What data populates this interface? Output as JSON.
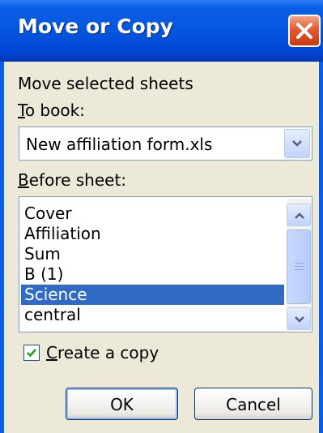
{
  "dialog": {
    "title": "Move or Copy",
    "intro": "Move selected sheets",
    "to_book_label_accel": "T",
    "to_book_label_rest": "o book:",
    "to_book_value": "New affiliation form.xls",
    "before_sheet_label_accel": "B",
    "before_sheet_label_rest": "efore sheet:",
    "sheets": [
      {
        "label": "Cover",
        "selected": false
      },
      {
        "label": "Affiliation",
        "selected": false
      },
      {
        "label": "Sum",
        "selected": false
      },
      {
        "label": "B (1)",
        "selected": false
      },
      {
        "label": "Science",
        "selected": true
      },
      {
        "label": "central",
        "selected": false
      }
    ],
    "create_copy_accel": "C",
    "create_copy_rest": "reate a copy",
    "create_copy_checked": true,
    "ok_label": "OK",
    "cancel_label": "Cancel"
  },
  "colors": {
    "titlebar": "#0556de",
    "selection": "#316ac5",
    "close": "#e35b31"
  },
  "icons": {
    "close": "close-icon",
    "dropdown": "chevron-down-icon",
    "scroll_up": "chevron-up-icon",
    "scroll_down": "chevron-down-icon",
    "check": "checkmark-icon"
  }
}
